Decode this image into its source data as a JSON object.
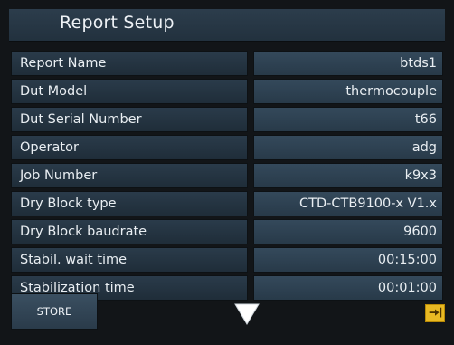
{
  "header": {
    "title": "Report Setup"
  },
  "fields": [
    {
      "label": "Report Name",
      "value": "btds1"
    },
    {
      "label": "Dut Model",
      "value": "thermocouple"
    },
    {
      "label": "Dut Serial Number",
      "value": "t66"
    },
    {
      "label": "Operator",
      "value": "adg"
    },
    {
      "label": "Job Number",
      "value": "k9x3"
    },
    {
      "label": "Dry Block type",
      "value": "CTD-CTB9100-x V1.x"
    },
    {
      "label": "Dry Block baudrate",
      "value": "9600"
    },
    {
      "label": "Stabil. wait time",
      "value": "00:15:00"
    },
    {
      "label": "Stabilization time",
      "value": "00:01:00"
    }
  ],
  "toolbar": {
    "store_label": "STORE",
    "down_icon": "down-triangle",
    "exit_icon": "exit-arrow",
    "accent_color": "#e8b923"
  },
  "colors": {
    "background": "#121518",
    "label_bg": "#2a3b4a",
    "value_bg": "#34495b",
    "text": "#e9eef2"
  }
}
